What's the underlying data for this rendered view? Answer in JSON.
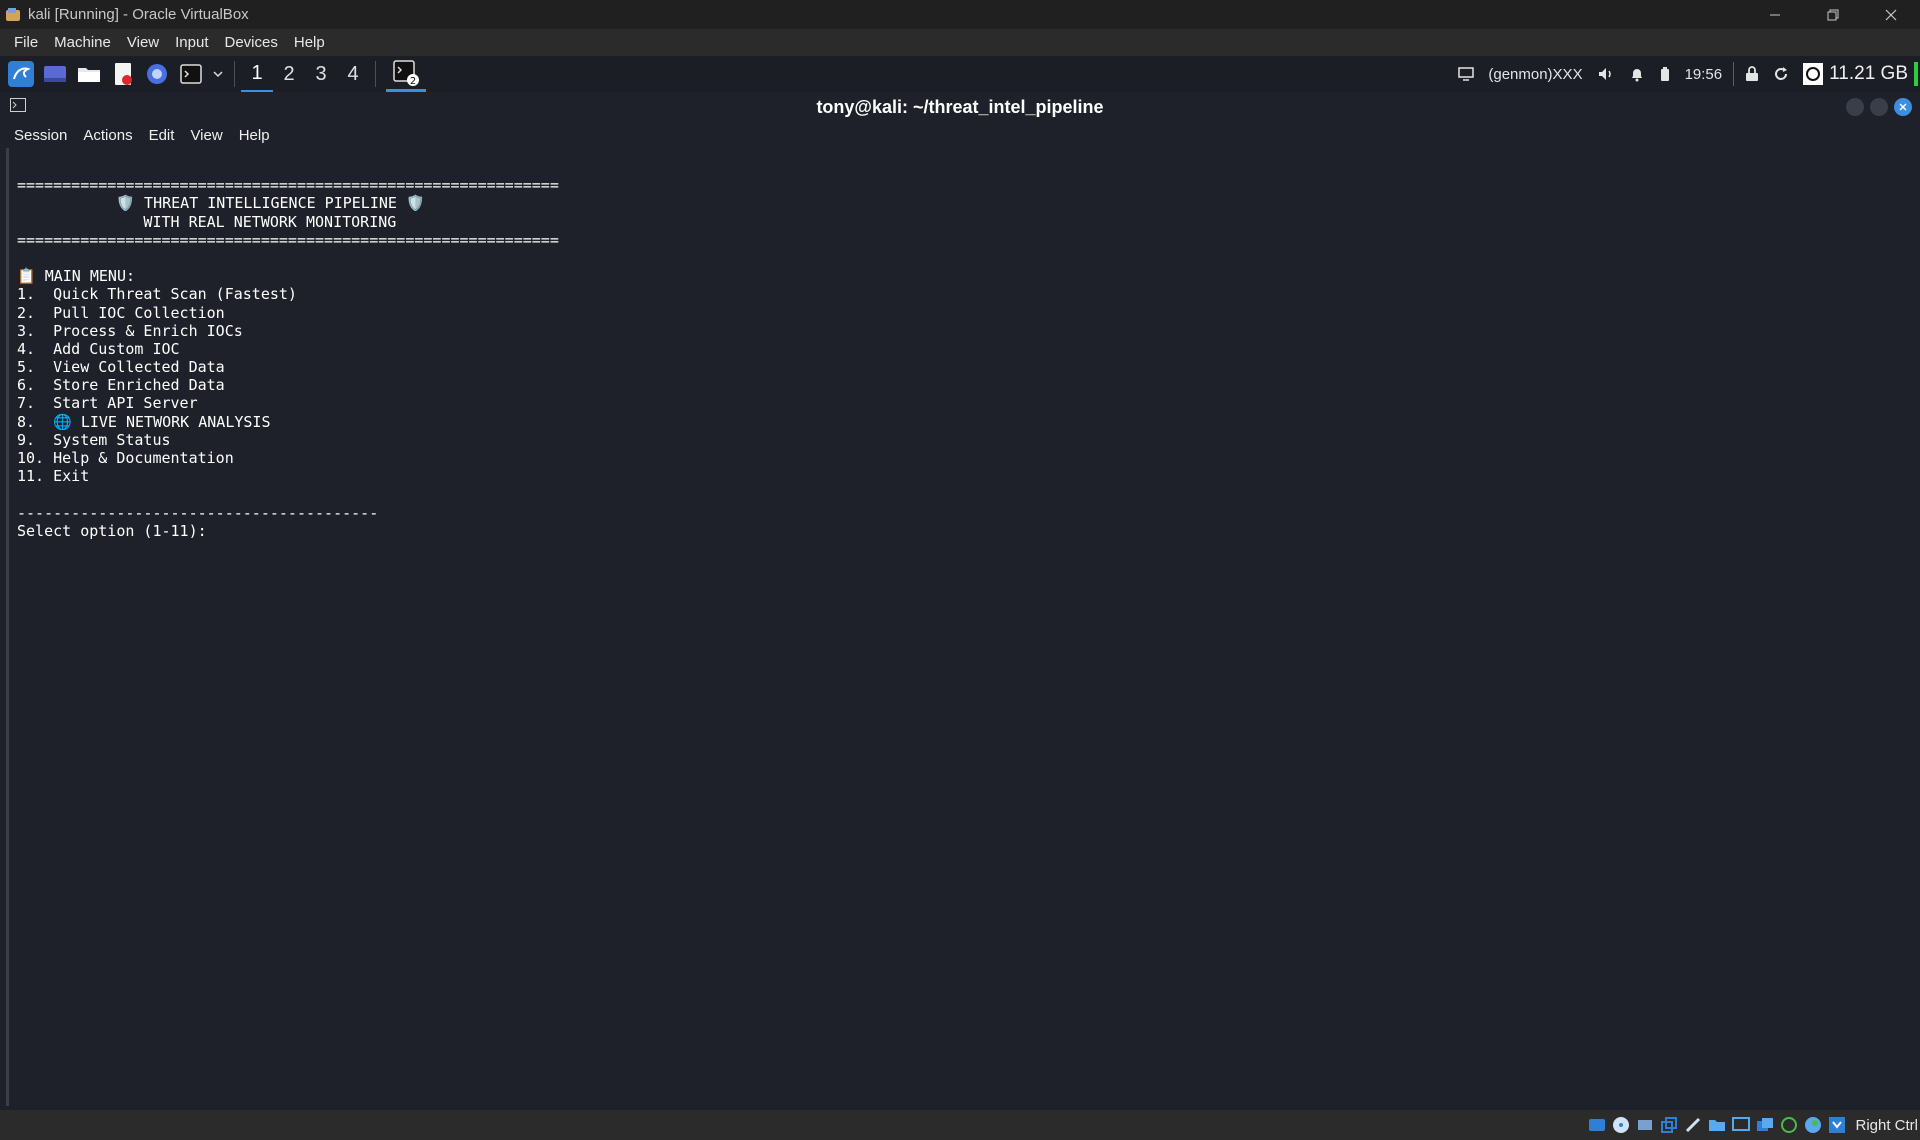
{
  "host_window": {
    "title": "kali [Running] - Oracle VirtualBox",
    "menu": [
      "File",
      "Machine",
      "View",
      "Input",
      "Devices",
      "Help"
    ]
  },
  "panel": {
    "workspaces": [
      "1",
      "2",
      "3",
      "4"
    ],
    "active_workspace": "1",
    "task_badge": "2",
    "genmon": "(genmon)XXX",
    "clock": "19:56",
    "memory": "11.21 GB"
  },
  "terminal": {
    "title": "tony@kali: ~/threat_intel_pipeline",
    "menu": [
      "Session",
      "Actions",
      "Edit",
      "View",
      "Help"
    ],
    "lines": [
      "",
      "============================================================",
      "           🛡️ THREAT INTELLIGENCE PIPELINE 🛡️",
      "              WITH REAL NETWORK MONITORING",
      "============================================================",
      "",
      "📋 MAIN MENU:",
      "1.  Quick Threat Scan (Fastest)",
      "2.  Pull IOC Collection",
      "3.  Process & Enrich IOCs",
      "4.  Add Custom IOC",
      "5.  View Collected Data",
      "6.  Store Enriched Data",
      "7.  Start API Server",
      "8.  🌐 LIVE NETWORK ANALYSIS",
      "9.  System Status",
      "10. Help & Documentation",
      "11. Exit",
      "",
      "----------------------------------------",
      "Select option (1-11): "
    ]
  },
  "statusbar": {
    "host_key": "Right Ctrl"
  },
  "colors": {
    "terminal_bg": "#1e2129",
    "panel_bg": "#1b1e25",
    "accent": "#3b8fe0"
  }
}
